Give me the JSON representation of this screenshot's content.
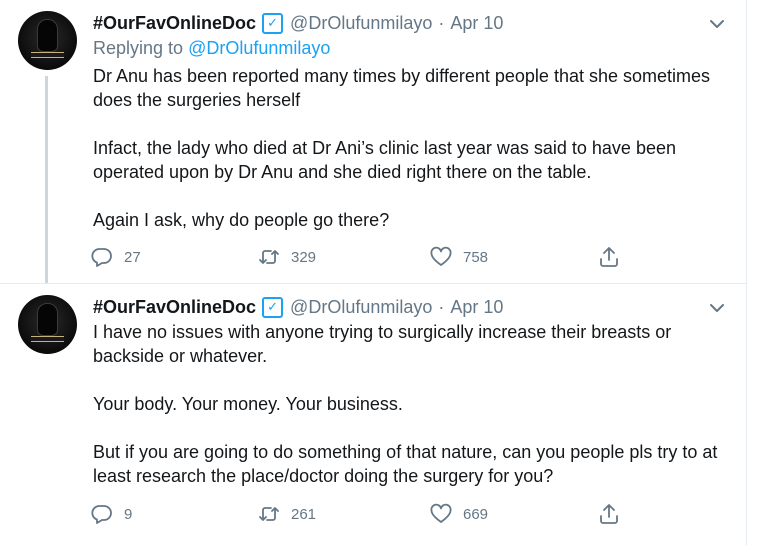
{
  "tweets": [
    {
      "name": "#OurFavOnlineDoc",
      "handle": "@DrOlufunmilayo",
      "date": "Apr 10",
      "replying_prefix": "Replying to",
      "replying_handle": "@DrOlufunmilayo",
      "paragraphs": [
        "Dr Anu has been reported many times by different people that she sometimes does the surgeries herself",
        "Infact, the lady who died at Dr Ani’s clinic last year was said to have been operated upon by Dr Anu and she died right there on the table.",
        "Again I ask, why do people go there?"
      ],
      "replies": "27",
      "retweets": "329",
      "likes": "758"
    },
    {
      "name": "#OurFavOnlineDoc",
      "handle": "@DrOlufunmilayo",
      "date": "Apr 10",
      "paragraphs": [
        "I have no issues with anyone trying to surgically increase their breasts or backside or whatever.",
        "Your body. Your money. Your business.",
        "But if you are going to do something of that nature, can you people pls try to at least research the place/doctor doing the surgery for you?"
      ],
      "replies": "9",
      "retweets": "261",
      "likes": "669"
    }
  ],
  "separator": "·",
  "icons": {
    "verified": "verified-badge-icon",
    "caret": "chevron-down-icon",
    "reply": "reply-icon",
    "retweet": "retweet-icon",
    "like": "heart-icon",
    "share": "share-icon"
  },
  "colors": {
    "text": "#14171a",
    "secondary": "#657786",
    "link": "#1da1f2",
    "border": "#e6ecf0",
    "thread_line": "#ccd6dd"
  }
}
